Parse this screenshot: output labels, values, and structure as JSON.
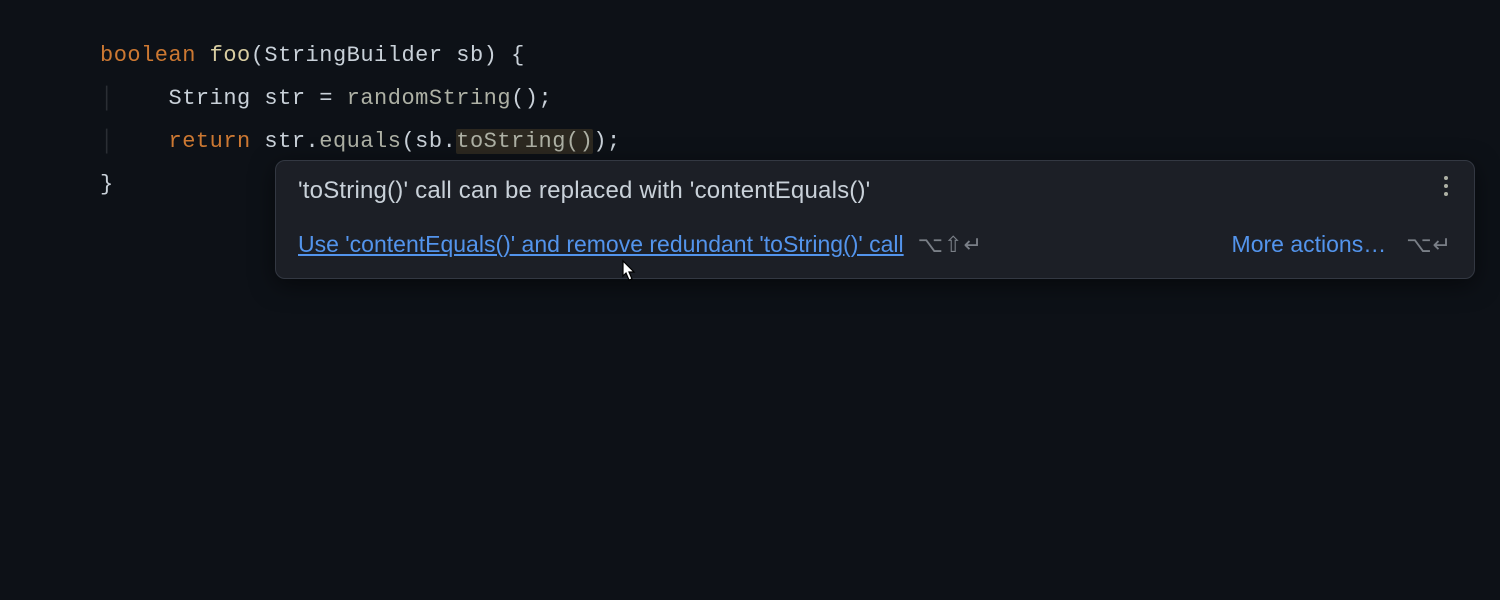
{
  "code": {
    "line1_kw": "boolean",
    "line1_fn": " foo",
    "line1_rest": "(StringBuilder sb) {",
    "line2_indent": "    ",
    "line2_a": "String str = ",
    "line2_call": "randomString",
    "line2_b": "();",
    "line3_indent": "    ",
    "line3_kw": "return",
    "line3_a": " str.",
    "line3_eq": "equals",
    "line3_b": "(sb.",
    "line3_warn": "toString()",
    "line3_c": ");",
    "line4": "}"
  },
  "tooltip": {
    "title": "'toString()' call can be replaced with 'contentEquals()'",
    "quickfix": "Use 'contentEquals()' and remove redundant 'toString()' call",
    "quickfix_shortcut": "⌥⇧↵",
    "more": "More actions…",
    "more_shortcut": "⌥↵"
  }
}
